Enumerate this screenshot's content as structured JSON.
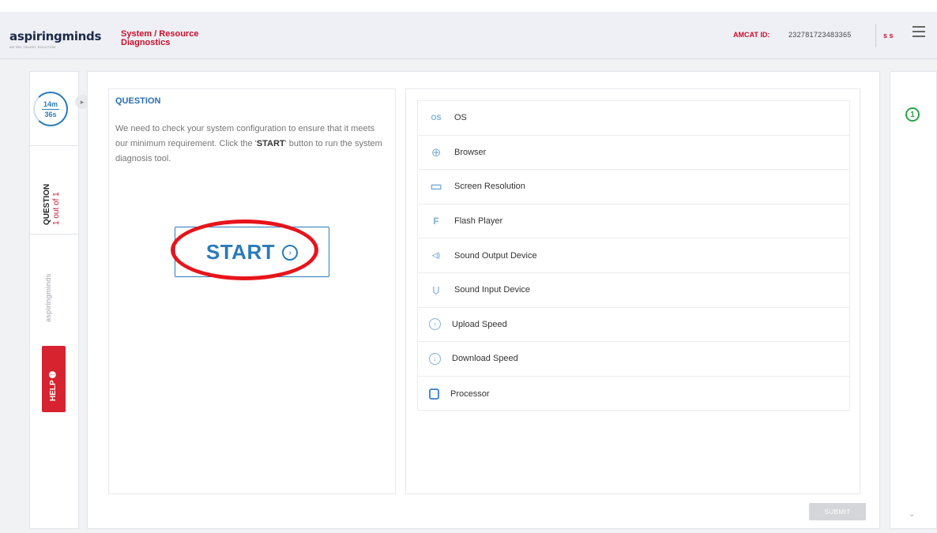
{
  "header": {
    "logo_part1": "aspiring",
    "logo_part2": "minds",
    "logo_tagline": "AN SHL TALENT SOLUTION",
    "title_line1": "System / Resource",
    "title_line2": "Diagnostics",
    "amcat_label": "AMCAT ID:",
    "amcat_id": "232781723483365",
    "user_initials": "s s"
  },
  "left_rail": {
    "timer_minutes": "14m",
    "timer_seconds": "36s",
    "question_label": "QUESTION",
    "question_count": "1 out of 1",
    "logo_text": "aspiringminds",
    "help_label": "HELP ➊"
  },
  "question": {
    "label": "QUESTION",
    "text_before": "We need to check your system configuration to ensure that it meets our minimum requirement. Click the '",
    "text_bold": "START",
    "text_after": "' button to run the system diagnosis tool.",
    "start_label": "START"
  },
  "diagnostics": [
    {
      "icon": "os-icon",
      "glyph": "OS",
      "label": "OS"
    },
    {
      "icon": "globe-icon",
      "glyph": "⊕",
      "label": "Browser"
    },
    {
      "icon": "monitor-icon",
      "glyph": "▭",
      "label": "Screen Resolution"
    },
    {
      "icon": "flash-icon",
      "glyph": "F",
      "label": "Flash Player"
    },
    {
      "icon": "speaker-icon",
      "glyph": "◁)",
      "label": "Sound Output Device"
    },
    {
      "icon": "microphone-icon",
      "glyph": "Ụ",
      "label": "Sound Input Device"
    },
    {
      "icon": "upload-icon",
      "glyph": "↑",
      "label": "Upload Speed"
    },
    {
      "icon": "download-icon",
      "glyph": "↓",
      "label": "Download Speed"
    },
    {
      "icon": "processor-icon",
      "glyph": "",
      "label": "Processor"
    }
  ],
  "submit_label": "SUBMIT",
  "right_rail": {
    "question_number": "1"
  },
  "colors": {
    "brand_red": "#c8102e",
    "accent_blue": "#2a7bb8",
    "success_green": "#29a745",
    "annotation_red": "#e8141b"
  }
}
